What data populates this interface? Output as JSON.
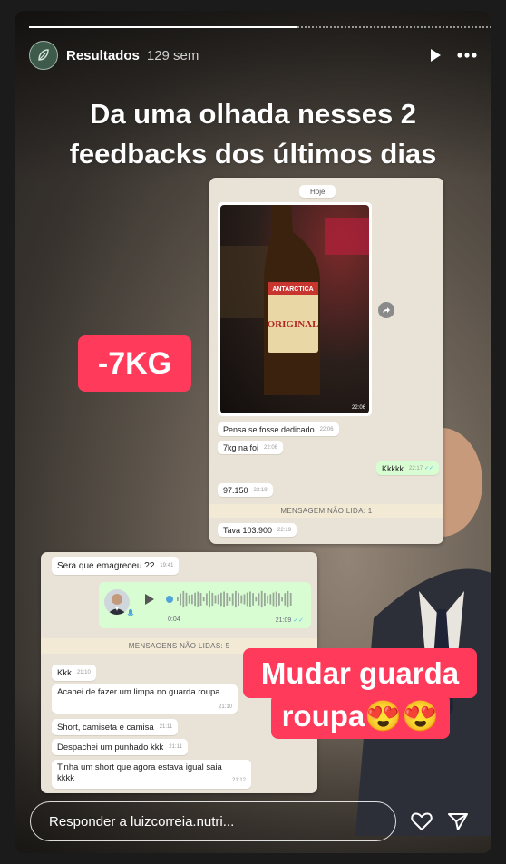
{
  "story": {
    "progress_fraction": 0.58,
    "account_name": "Resultados",
    "time_ago": "129 sem",
    "headline_line1": "Da uma olhada nesses 2",
    "headline_line2": "feedbacks dos últimos dias",
    "label_weight": "-7KG",
    "label_wardrobe_line1": "Mudar guarda",
    "label_wardrobe_line2": "roupa😍😍"
  },
  "chat1": {
    "date_chip": "Hoje",
    "photo_brand": "ANTARCTICA",
    "photo_label": "ORIGINAL",
    "photo_time": "22:06",
    "messages": [
      {
        "text": "Pensa se fosse dedicado",
        "time": "22:06"
      },
      {
        "text": "7kg na foi",
        "time": "22:06"
      },
      {
        "text": "Kkkkk",
        "time": "22:17"
      },
      {
        "text": "97.150",
        "time": "22:19"
      },
      {
        "text": "Tava 103.900",
        "time": "22:19"
      }
    ],
    "unread_banner": "MENSAGEM NÃO LIDA: 1"
  },
  "chat2": {
    "messages_top": [
      {
        "text": "Sera que emagreceu ??",
        "time": "19:41"
      }
    ],
    "voice_duration": "0:04",
    "voice_time": "21:09",
    "unread_banner": "MENSAGENS NÃO LIDAS: 5",
    "messages": [
      {
        "text": "Kkk",
        "time": "21:10"
      },
      {
        "text": "Acabei de fazer um limpa no guarda roupa",
        "time": "21:10"
      },
      {
        "text": "Short, camiseta e camisa",
        "time": "21:11"
      },
      {
        "text": "Despachei um punhado kkk",
        "time": "21:11"
      },
      {
        "text": "Tinha um short que agora estava igual saia kkkk",
        "time": "21:12"
      }
    ]
  },
  "footer": {
    "reply_placeholder": "Responder a luizcorreia.nutri..."
  },
  "colors": {
    "accent_red": "#ff3a5a",
    "chat_bg": "#e9e2d6",
    "sent_bubble": "#d9fdd3"
  },
  "icons": [
    "leaf-avatar-icon",
    "play-icon",
    "more-icon",
    "forward-icon",
    "mic-icon",
    "heart-icon",
    "send-icon"
  ]
}
